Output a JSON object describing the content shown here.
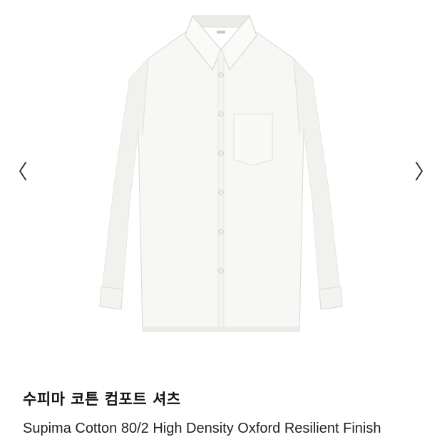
{
  "colors": {
    "background": "#ffffff",
    "title": "#111111",
    "subtitle": "#222222",
    "shirt": "#f7f7f5",
    "shirt_shadow": "#e4e4e1",
    "button": "#efeee6",
    "arrow": "#333333"
  },
  "gallery": {
    "prev_icon": "chevron-left-icon",
    "next_icon": "chevron-right-icon",
    "image_subject": "white-shirt-image"
  },
  "product": {
    "name_ko": "수피마 코튼 컴포트 셔츠",
    "name_en": "Supima Cotton 80/2 High Density Oxford Resilient Finish"
  }
}
